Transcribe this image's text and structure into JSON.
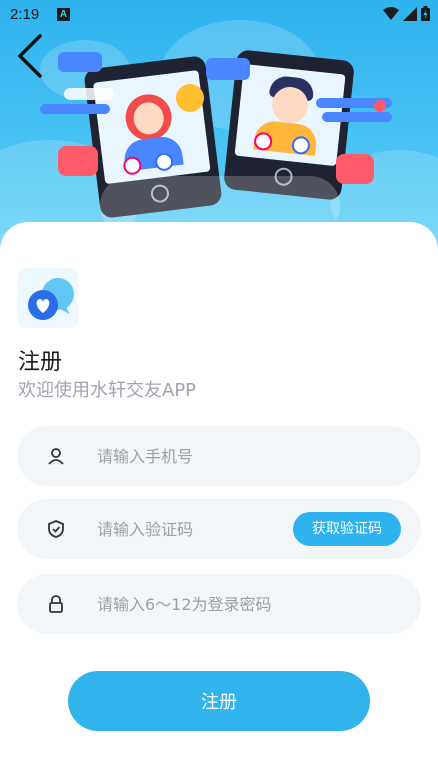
{
  "status_bar": {
    "time": "2:19",
    "notification_letter": "A"
  },
  "page": {
    "title": "注册",
    "subtitle": "欢迎使用水轩交友APP"
  },
  "form": {
    "phone_placeholder": "请输入手机号",
    "code_placeholder": "请输入验证码",
    "get_code_label": "获取验证码",
    "password_placeholder": "请输入6～12为登录密码"
  },
  "actions": {
    "register_label": "注册"
  },
  "colors": {
    "accent": "#31b4ec",
    "hero": "#46c2f4",
    "heart": "#ff5a6a",
    "field_bg": "#f3f6f8"
  }
}
